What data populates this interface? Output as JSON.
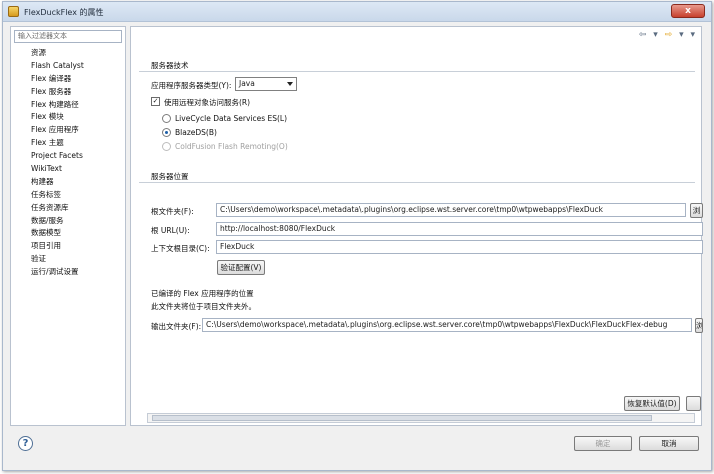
{
  "window": {
    "title": "FlexDuckFlex 的属性",
    "close_label": "x"
  },
  "sidebar": {
    "filter_placeholder": "输入过滤器文本",
    "items": [
      "资源",
      "Flash Catalyst",
      "Flex 编译器",
      "Flex 服务器",
      "Flex 构建路径",
      "Flex 模块",
      "Flex 应用程序",
      "Flex 主题",
      "Project Facets",
      "WikiText",
      "构建器",
      "任务标签",
      "任务资源库",
      "数据/服务",
      "数据模型",
      "项目引用",
      "验证",
      "运行/调试设置"
    ]
  },
  "nav": {
    "back": "⇦",
    "forward": "⇨",
    "menu": "▾"
  },
  "server_tech": {
    "section_label": "服务器技术",
    "type_label": "应用程序服务器类型(Y):",
    "type_value": "Java",
    "remote_access_label": "使用远程对象访问服务(R)",
    "remote_access_checked": true,
    "options": [
      {
        "label": "LiveCycle Data Services ES(L)",
        "selected": false,
        "disabled": false
      },
      {
        "label": "BlazeDS(B)",
        "selected": true,
        "disabled": false
      },
      {
        "label": "ColdFusion Flash Remoting(O)",
        "selected": false,
        "disabled": true
      }
    ]
  },
  "server_location": {
    "section_label": "服务器位置",
    "root_folder_label": "根文件夹(F):",
    "root_folder_value": "C:\\Users\\demo\\workspace\\.metadata\\.plugins\\org.eclipse.wst.server.core\\tmp0\\wtpwebapps\\FlexDuck",
    "browse_label": "浏",
    "root_url_label": "根 URL(U):",
    "root_url_value": "http://localhost:8080/FlexDuck",
    "context_root_label": "上下文根目录(C):",
    "context_root_value": "FlexDuck",
    "validate_label": "验证配置(V)"
  },
  "output": {
    "section_label": "已编译的 Flex 应用程序的位置",
    "description": "此文件夹将位于项目文件夹外。",
    "output_folder_label": "输出文件夹(F):",
    "output_folder_value": "C:\\Users\\demo\\workspace\\.metadata\\.plugins\\org.eclipse.wst.server.core\\tmp0\\wtpwebapps\\FlexDuck\\FlexDuckFlex-debug",
    "browse_label": "浏"
  },
  "buttons": {
    "restore_defaults": "恢复默认值(D)",
    "ok": "确定",
    "cancel": "取消",
    "help": "?"
  }
}
